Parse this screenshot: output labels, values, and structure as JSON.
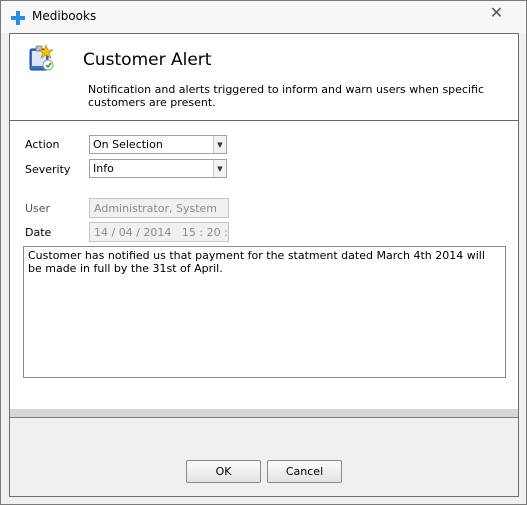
{
  "window": {
    "title": "Medibooks",
    "close_glyph": "✕"
  },
  "header": {
    "title": "Customer Alert",
    "description": "Notification and alerts triggered to inform and warn users when specific customers are present."
  },
  "form": {
    "action_label": "Action",
    "action_value": "On Selection",
    "severity_label": "Severity",
    "severity_value": "Info",
    "user_label": "User",
    "user_value": "Administrator, System",
    "date_label": "Date",
    "date_value": "14 / 04 / 2014   15 : 20 :",
    "message": "Customer has notified us that payment for the statment dated March 4th 2014 will be made in full by the 31st of April."
  },
  "buttons": {
    "ok_label": "OK",
    "cancel_label": "Cancel"
  },
  "icons": {
    "app": "plus-icon",
    "header": "alert-notepad-icon",
    "dropdown": "dropdown-arrow-icon"
  },
  "colors": {
    "app_icon": "#2a8ee0"
  }
}
